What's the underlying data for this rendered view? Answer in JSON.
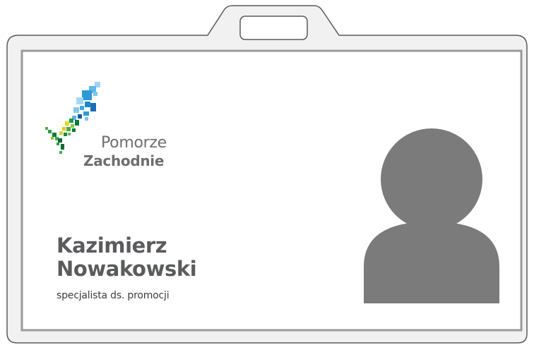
{
  "badge": {
    "logo": {
      "name": "Pomorze",
      "name_line2": "Zachodnie"
    },
    "person": {
      "first_name": "Kazimierz",
      "last_name": "Nowakowski",
      "role": "specjalista ds. promocji"
    },
    "photo": {
      "icon": "user-silhouette-icon"
    },
    "colors": {
      "frame_stroke": "#555555",
      "frame_fill": "#f0f0f0",
      "card_border": "#8f8f8f",
      "silhouette": "#7b7b7b",
      "text_dark": "#5a5b5e"
    }
  }
}
